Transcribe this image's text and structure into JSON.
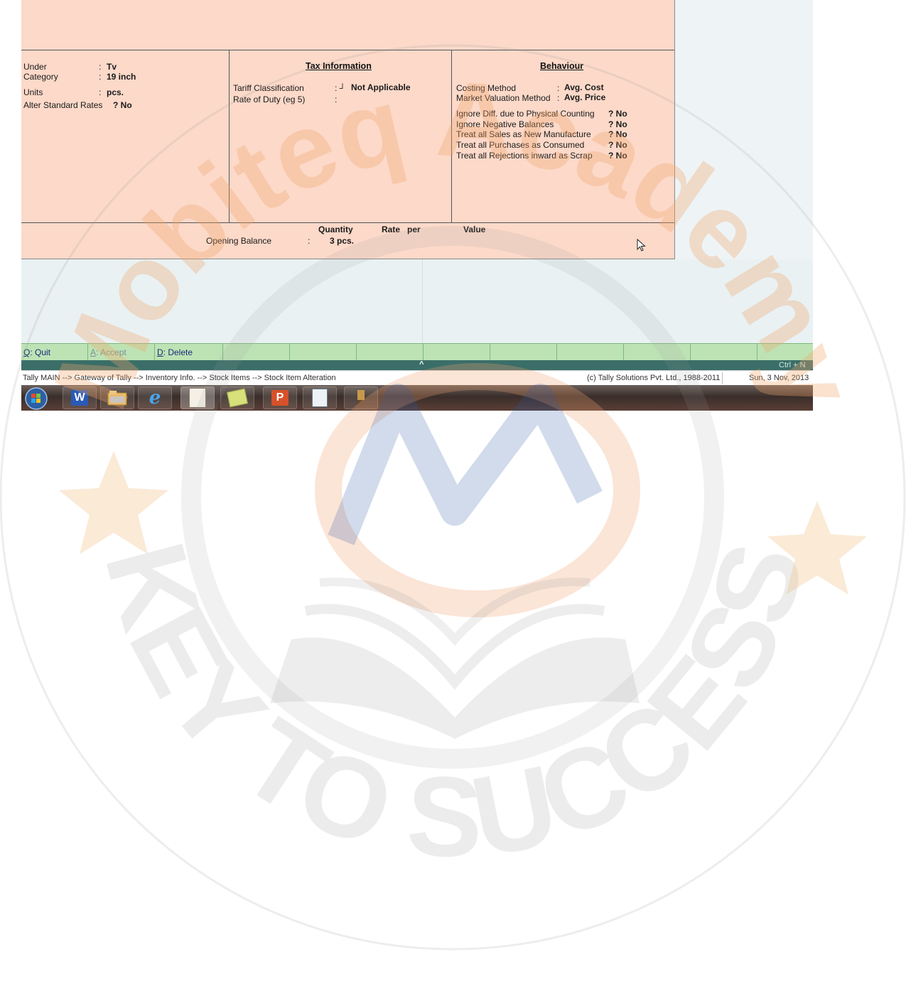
{
  "stock_item": {
    "fields": [
      {
        "label": "Under",
        "value": "Tv"
      },
      {
        "label": "Category",
        "value": "19 inch"
      },
      {
        "label": "Units",
        "value": "pcs."
      }
    ],
    "alter_standard_rates": {
      "label": "Alter Standard Rates",
      "value": "? No"
    }
  },
  "tax": {
    "heading": "Tax Information",
    "tariff_label": "Tariff Classification",
    "tariff_value": "Not Applicable",
    "rate_label": "Rate of Duty (eg 5)"
  },
  "behaviour": {
    "heading": "Behaviour",
    "costing_label": "Costing Method",
    "costing_value": "Avg. Cost",
    "market_label": "Market Valuation Method",
    "market_value": "Avg. Price",
    "flags": [
      {
        "label": "Ignore Diff. due to Physical Counting",
        "value": "? No"
      },
      {
        "label": "Ignore Negative Balances",
        "value": "? No"
      },
      {
        "label": "Treat all Sales as New Manufacture",
        "value": "? No"
      },
      {
        "label": "Treat all Purchases as Consumed",
        "value": "? No"
      },
      {
        "label": "Treat all Rejections inward as Scrap",
        "value": "? No"
      }
    ]
  },
  "opening": {
    "col_quantity": "Quantity",
    "col_rate": "Rate",
    "col_per": "per",
    "col_value": "Value",
    "label": "Opening Balance",
    "quantity": "3 pcs."
  },
  "buttons": {
    "quit_key": "Q",
    "quit_label": ": Quit",
    "accept_key": "A",
    "accept_label": ": Accept",
    "delete_key": "D",
    "delete_label": ": Delete"
  },
  "strip": {
    "shortcut": "Ctrl + N",
    "arrow": "^"
  },
  "status": {
    "breadcrumb": "Tally MAIN --> Gateway of Tally --> Inventory Info. --> Stock Items --> Stock Item Alteration",
    "copyright": "(c) Tally Solutions Pvt. Ltd., 1988-2011",
    "date": "Sun, 3 Nov, 2013"
  },
  "taskbar": {
    "icons": [
      "start-orb-icon",
      "word-icon",
      "explorer-icon",
      "ie-icon",
      "tally-erp-icon",
      "sticky-notes-icon",
      "powerpoint-icon",
      "calculator-icon",
      "paint-icon"
    ],
    "word_letter": "W",
    "ppt_letter": "P"
  },
  "watermark": {
    "brand": "Mobiteq Academy",
    "tagline": "KEY TO SUCCESS",
    "colors": {
      "orange": "#f2a66a",
      "blue": "#2f5aa8",
      "grey": "#8c8c8c",
      "red": "#d44b2a"
    }
  }
}
